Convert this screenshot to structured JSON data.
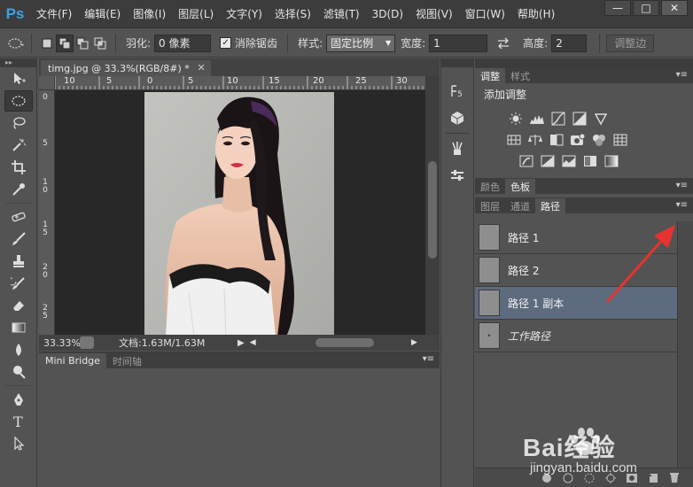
{
  "app": {
    "logo": "Ps",
    "menu": [
      "文件(F)",
      "编辑(E)",
      "图像(I)",
      "图层(L)",
      "文字(Y)",
      "选择(S)",
      "滤镜(T)",
      "3D(D)",
      "视图(V)",
      "窗口(W)",
      "帮助(H)"
    ],
    "window_controls": [
      "—",
      "□",
      "✕"
    ]
  },
  "options": {
    "feather_label": "羽化:",
    "feather_value": "0 像素",
    "antialias_label": "消除锯齿",
    "style_label": "样式:",
    "style_value": "固定比例",
    "width_label": "宽度:",
    "width_value": "1",
    "height_label": "高度:",
    "height_value": "2",
    "refine_label": "调整边"
  },
  "document": {
    "tab_title": "timg.jpg @ 33.3%(RGB/8#) *",
    "tab_close": "✕",
    "ruler_h": [
      "10",
      "5",
      "0",
      "5",
      "10",
      "15",
      "20",
      "25",
      "30"
    ],
    "ruler_v": [
      "0",
      "5",
      "1\n0",
      "1\n5",
      "2\n0",
      "2\n5"
    ],
    "zoom": "33.33%",
    "doc_size": "文档:1.63M/1.63M"
  },
  "bottom_panel": {
    "tabs": [
      "Mini Bridge",
      "时间轴"
    ]
  },
  "adjustments": {
    "tabs": [
      "调整",
      "样式"
    ],
    "title": "添加调整"
  },
  "swatches": {
    "tabs": [
      "颜色",
      "色板"
    ]
  },
  "paths_panel": {
    "tabs": [
      "图层",
      "通道",
      "路径"
    ],
    "items": [
      {
        "label": "路径 1",
        "selected": false,
        "work": false
      },
      {
        "label": "路径 2",
        "selected": false,
        "work": false
      },
      {
        "label": "路径 1 副本",
        "selected": true,
        "work": false
      },
      {
        "label": "工作路径",
        "selected": false,
        "work": true
      }
    ]
  },
  "watermark": {
    "brand": "Bai经验",
    "url": "jingyan.baidu.com"
  },
  "colors": {
    "ps_blue": "#3ca1e8",
    "selected_row": "#5d6b7e",
    "arrow_red": "#e8322f"
  }
}
